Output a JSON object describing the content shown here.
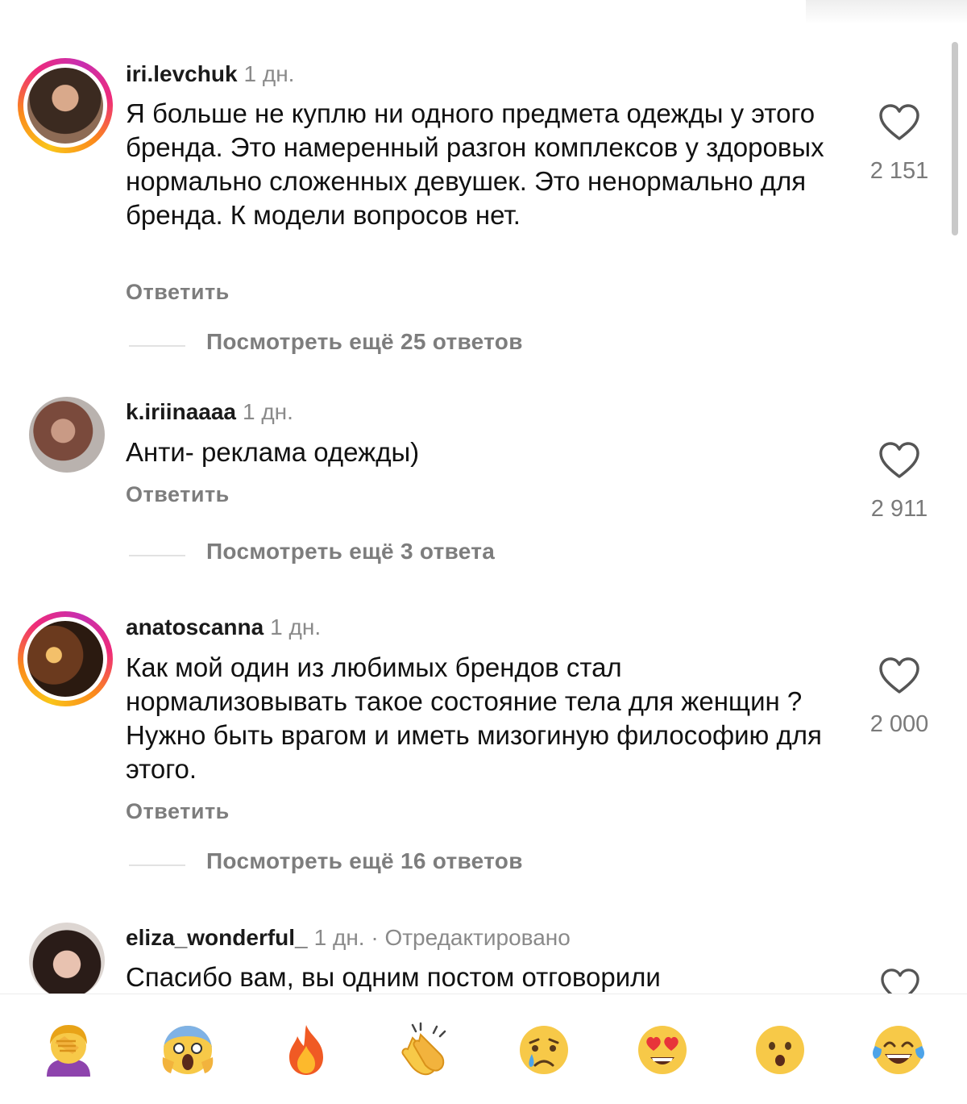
{
  "comments": [
    {
      "username": "iri.levchuk",
      "time": "1 дн.",
      "text": "Я больше не куплю ни одного предмета одежды у этого бренда.  Это намеренный разгон комплексов у здоровых нормально сложенных девушек. Это ненормально для бренда. К модели вопросов нет.",
      "reply_label": "Ответить",
      "view_more": "Посмотреть ещё 25 ответов",
      "likes": "2 151",
      "has_story": true
    },
    {
      "username": "k.iriinaaaa",
      "time": "1 дн.",
      "text": "Анти- реклама одежды)",
      "reply_label": "Ответить",
      "view_more": "Посмотреть ещё 3 ответа",
      "likes": "2 911",
      "has_story": false
    },
    {
      "username": "anatoscanna",
      "time": "1 дн.",
      "text": "Как мой один из любимых брендов стал нормализовывать такое состояние тела для женщин ? Нужно быть врагом и иметь мизогиную философию для этого.",
      "reply_label": "Ответить",
      "view_more": "Посмотреть ещё 16 ответов",
      "likes": "2 000",
      "has_story": true
    },
    {
      "username": "eliza_wonderful_",
      "time": "1 дн.",
      "edited": "· Отредактировано",
      "text": "Спасибо вам, вы одним постом отговорили",
      "has_story": false
    }
  ],
  "emoji_bar": {
    "items": [
      "🤦‍♀️",
      "😱",
      "🔥",
      "👏",
      "😢",
      "😍",
      "😮",
      "😂"
    ]
  },
  "colors": {
    "story_ring": [
      "#f9c51a",
      "#fb8a1b",
      "#ee2a7b",
      "#c72fb0"
    ],
    "muted_text": "#7d7d7d",
    "username": "#1a1a1a"
  },
  "icons": {
    "like": "heart-outline-icon"
  }
}
